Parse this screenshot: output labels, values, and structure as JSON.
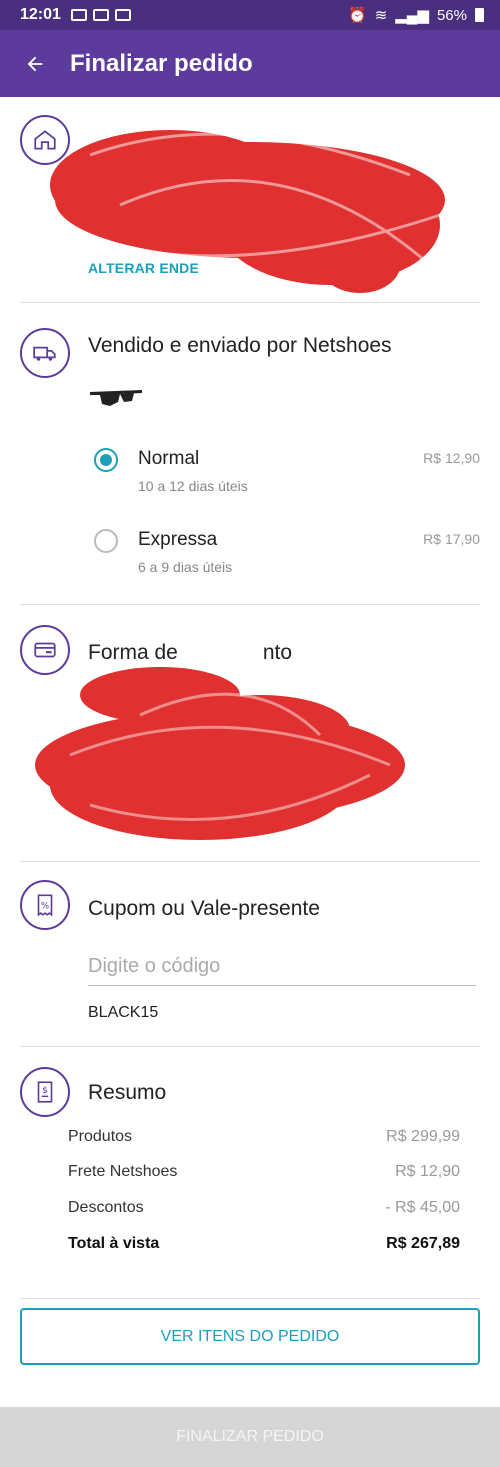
{
  "status_bar": {
    "time": "12:01",
    "battery": "56%"
  },
  "app_bar": {
    "back_icon": "arrow-left-icon",
    "title": "Finalizar pedido"
  },
  "address": {
    "icon": "home-icon",
    "change_link": "ALTERAR ENDE"
  },
  "shipping": {
    "icon": "truck-icon",
    "title": "Vendido e enviado por Netshoes",
    "product_icon": "sunglasses-icon",
    "options": [
      {
        "name": "Normal",
        "desc": "10 a 12 dias úteis",
        "price": "R$ 12,90",
        "selected": true
      },
      {
        "name": "Expressa",
        "desc": "6 a 9 dias úteis",
        "price": "R$ 17,90",
        "selected": false
      }
    ]
  },
  "payment": {
    "icon": "credit-card-icon",
    "title_start": "Forma de",
    "title_end": "nto"
  },
  "coupon": {
    "icon": "coupon-icon",
    "title": "Cupom ou Vale-presente",
    "placeholder": "Digite o código",
    "applied_code": "BLACK15"
  },
  "summary": {
    "icon": "receipt-icon",
    "title": "Resumo",
    "rows": [
      {
        "label": "Produtos",
        "value": "R$ 299,99"
      },
      {
        "label": "Frete Netshoes",
        "value": "R$ 12,90"
      },
      {
        "label": "Descontos",
        "value": "- R$ 45,00"
      }
    ],
    "total_label": "Total à vista",
    "total_value": "R$ 267,89"
  },
  "buttons": {
    "view_items": "VER ITENS DO PEDIDO",
    "finalize": "FINALIZAR PEDIDO"
  },
  "colors": {
    "primary_purple": "#5c3b9c",
    "accent_teal": "#1aa0b8",
    "scribble_red": "#e0302f"
  }
}
